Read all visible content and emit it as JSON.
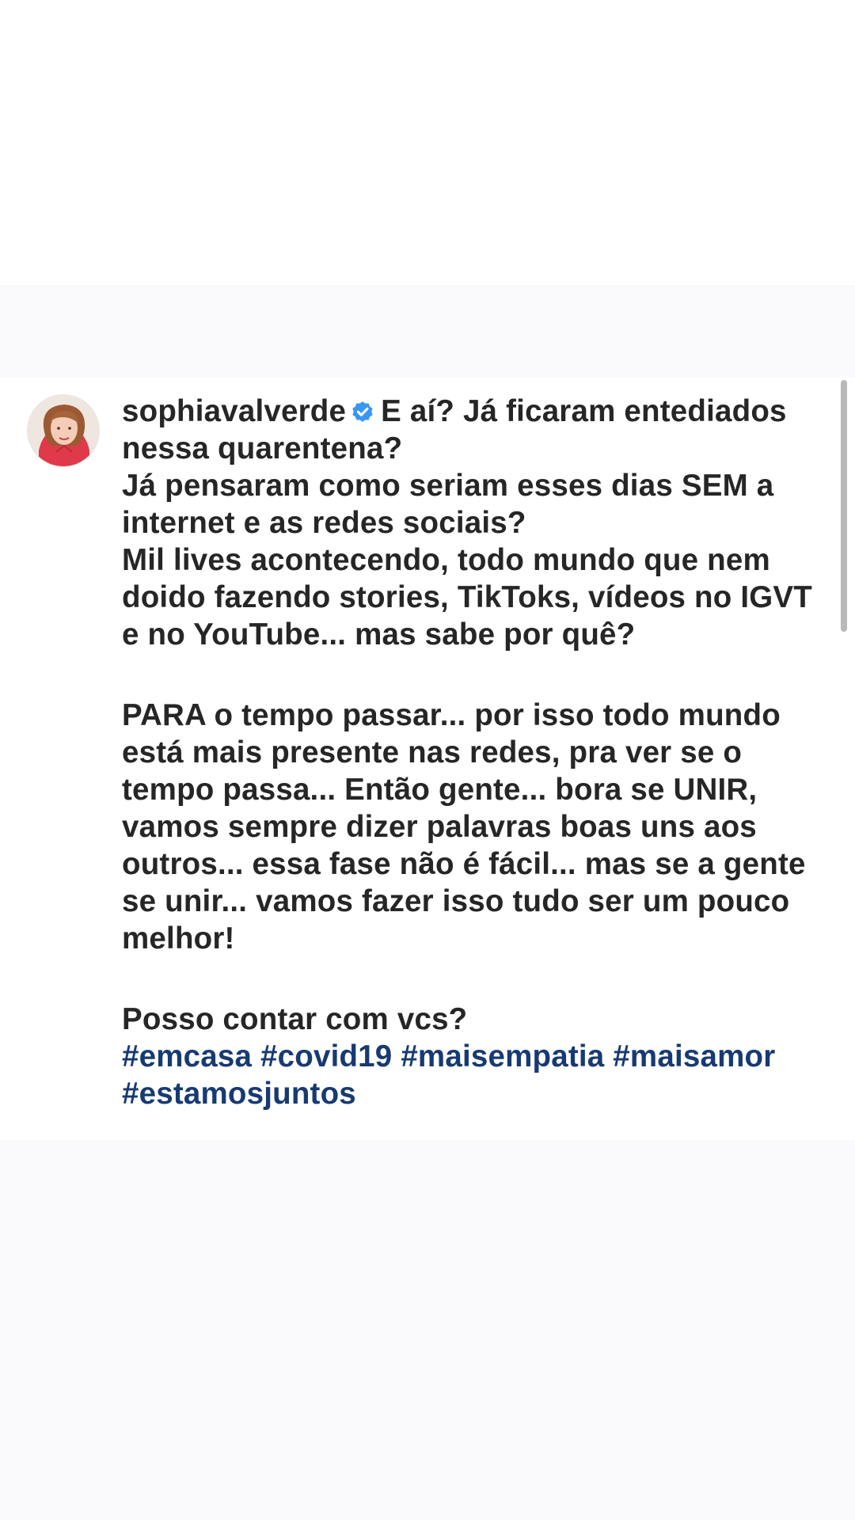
{
  "post": {
    "username": "sophiavalverde",
    "verified_icon": "verified-badge-icon",
    "paragraphs": [
      "E aí? Já ficaram entediados nessa quarentena?",
      "Já pensaram como seriam esses dias SEM a internet e as redes sociais?",
      "Mil lives acontecendo, todo mundo que nem doido fazendo stories, TikToks, vídeos no IGVT e no YouTube... mas sabe por quê?",
      "PARA o tempo passar... por isso todo mundo está mais presente nas redes, pra ver se o tempo passa... Então gente... bora se UNIR, vamos sempre dizer palavras boas uns aos outros... essa fase não é fácil... mas se a gente se unir... vamos fazer isso tudo ser um pouco melhor!",
      "Posso contar com vcs?"
    ],
    "hashtags": [
      "#emcasa",
      "#covid19",
      "#maisempatia",
      "#maisamor",
      "#estamosjuntos"
    ]
  },
  "colors": {
    "text": "#262626",
    "hashtag": "#173a72",
    "verified": "#3897f0",
    "page_tint": "#fafafc"
  }
}
